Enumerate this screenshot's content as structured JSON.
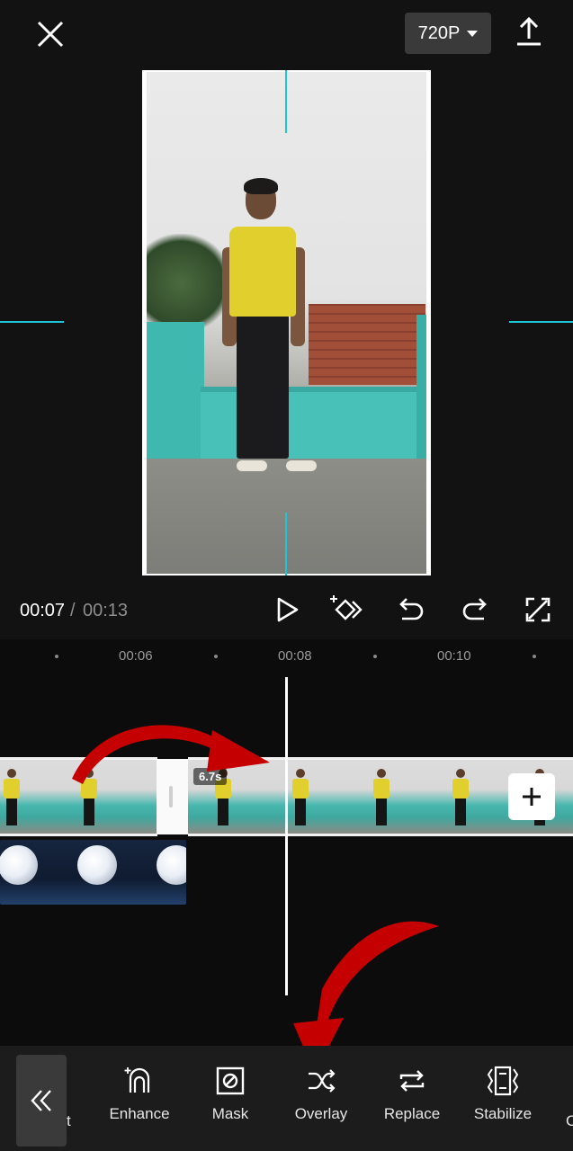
{
  "topbar": {
    "resolution_label": "720P",
    "close_icon": "close-icon",
    "export_icon": "export-icon"
  },
  "playback": {
    "current_time": "00:07",
    "separator": "/",
    "total_time": "00:13",
    "icons": [
      "play-icon",
      "keyframe-icon",
      "undo-icon",
      "redo-icon",
      "fullscreen-icon"
    ]
  },
  "timeline": {
    "ruler_labels": [
      "00:06",
      "00:08",
      "00:10"
    ],
    "clip_duration_badge": "6.7s",
    "add_clip_icon": "plus-icon"
  },
  "toolbar": {
    "collapse_icon": "double-chevron-left-icon",
    "partial_label": "t",
    "edge_label": "C",
    "items": [
      {
        "label": "Enhance",
        "icon": "enhance-icon"
      },
      {
        "label": "Mask",
        "icon": "mask-icon"
      },
      {
        "label": "Overlay",
        "icon": "overlay-shuffle-icon"
      },
      {
        "label": "Replace",
        "icon": "replace-icon"
      },
      {
        "label": "Stabilize",
        "icon": "stabilize-icon"
      }
    ]
  },
  "colors": {
    "background": "#121212",
    "guide_accent": "#1ec5d8",
    "arrow_red": "#c40000",
    "toolbar_bg": "#1c1c1c"
  }
}
